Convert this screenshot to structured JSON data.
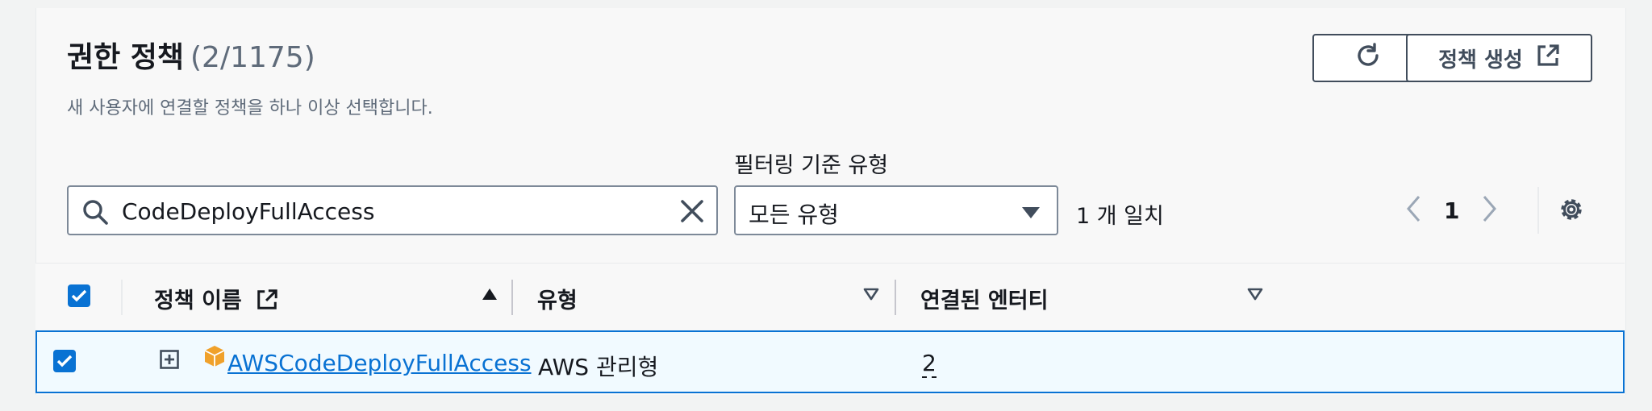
{
  "header": {
    "title": "권한 정책",
    "count": "(2/1175)",
    "description": "새 사용자에 연결할 정책을 하나 이상 선택합니다.",
    "create_label": "정책 생성"
  },
  "filter": {
    "label": "필터링 기준 유형",
    "search_value": "CodeDeployFullAccess",
    "type_value": "모든 유형",
    "match_text": "1 개 일치"
  },
  "pager": {
    "current_page": "1"
  },
  "table": {
    "columns": [
      "정책 이름",
      "유형",
      "연결된 엔터티"
    ],
    "rows": [
      {
        "name": "AWSCodeDeployFullAccess",
        "type": "AWS 관리형",
        "entities": "2"
      }
    ]
  },
  "colors": {
    "accent": "#0972d3",
    "border": "#414d5c",
    "text": "#16191f",
    "muted": "#5f6b7a",
    "orange": "#f0a12b"
  }
}
